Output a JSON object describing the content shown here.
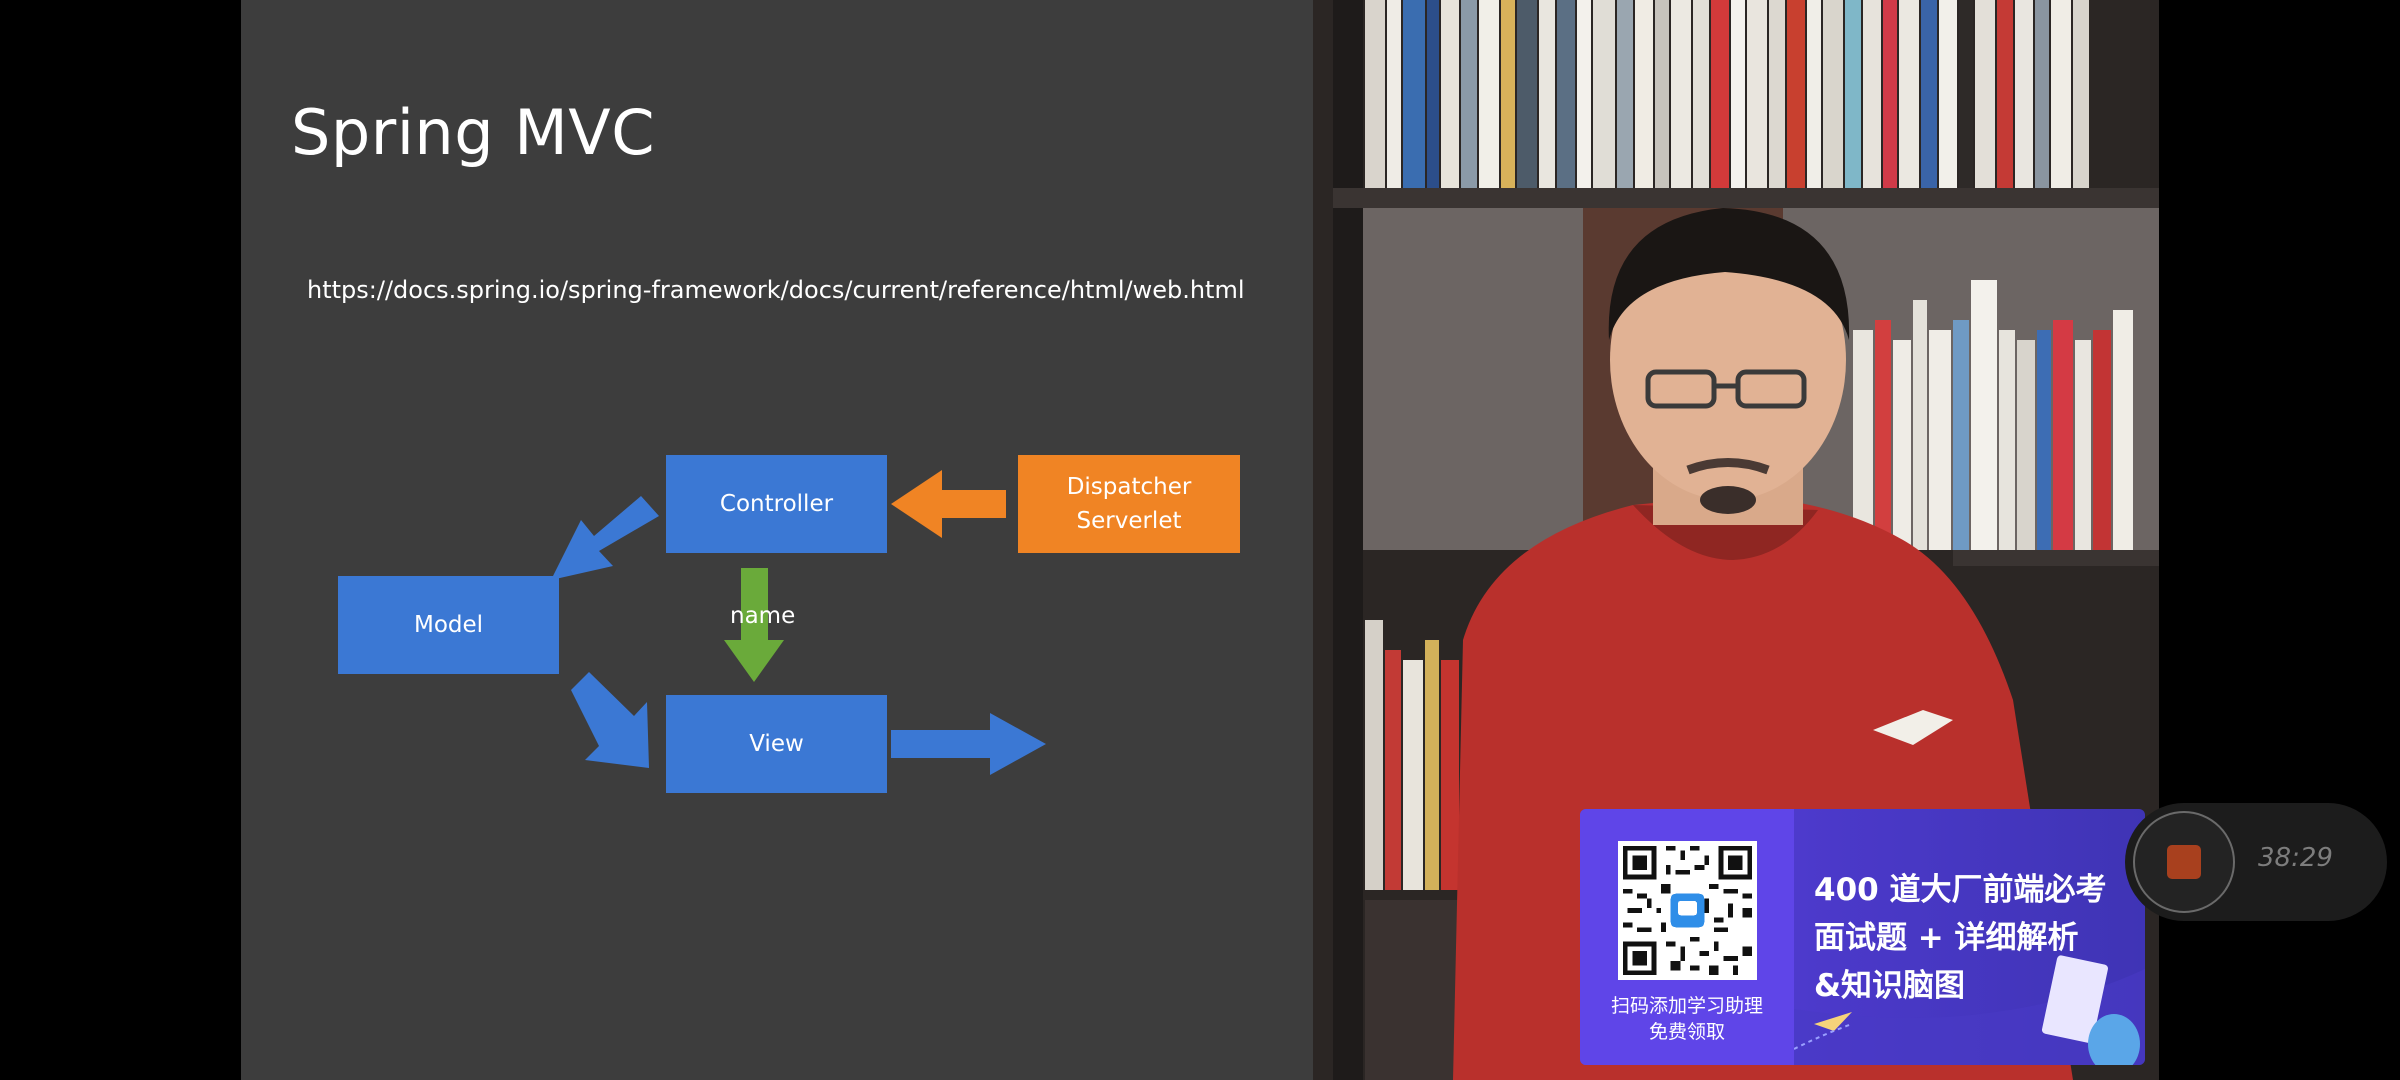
{
  "slide": {
    "title": "Spring MVC",
    "url": "https://docs.spring.io/spring-framework/docs/current/reference/html/web.html",
    "diagram": {
      "controller": "Controller",
      "dispatcher": "Dispatcher\nServerlet",
      "model": "Model",
      "view": "View",
      "edge_label": "name"
    }
  },
  "promo": {
    "qr_caption_line1": "扫码添加学习助理",
    "qr_caption_line2": "免费领取",
    "headline_line1": "400 道大厂前端必考",
    "headline_line2": "面试题 + 详细解析",
    "headline_line3": "&知识脑图"
  },
  "recorder": {
    "elapsed": "38:29"
  },
  "colors": {
    "slide_bg": "#3d3d3d",
    "box_blue": "#3b78d4",
    "box_orange": "#f08424",
    "arrow_green": "#6aaa3a",
    "promo_purple": "#5a3fe0",
    "record_red": "#a8401e"
  }
}
